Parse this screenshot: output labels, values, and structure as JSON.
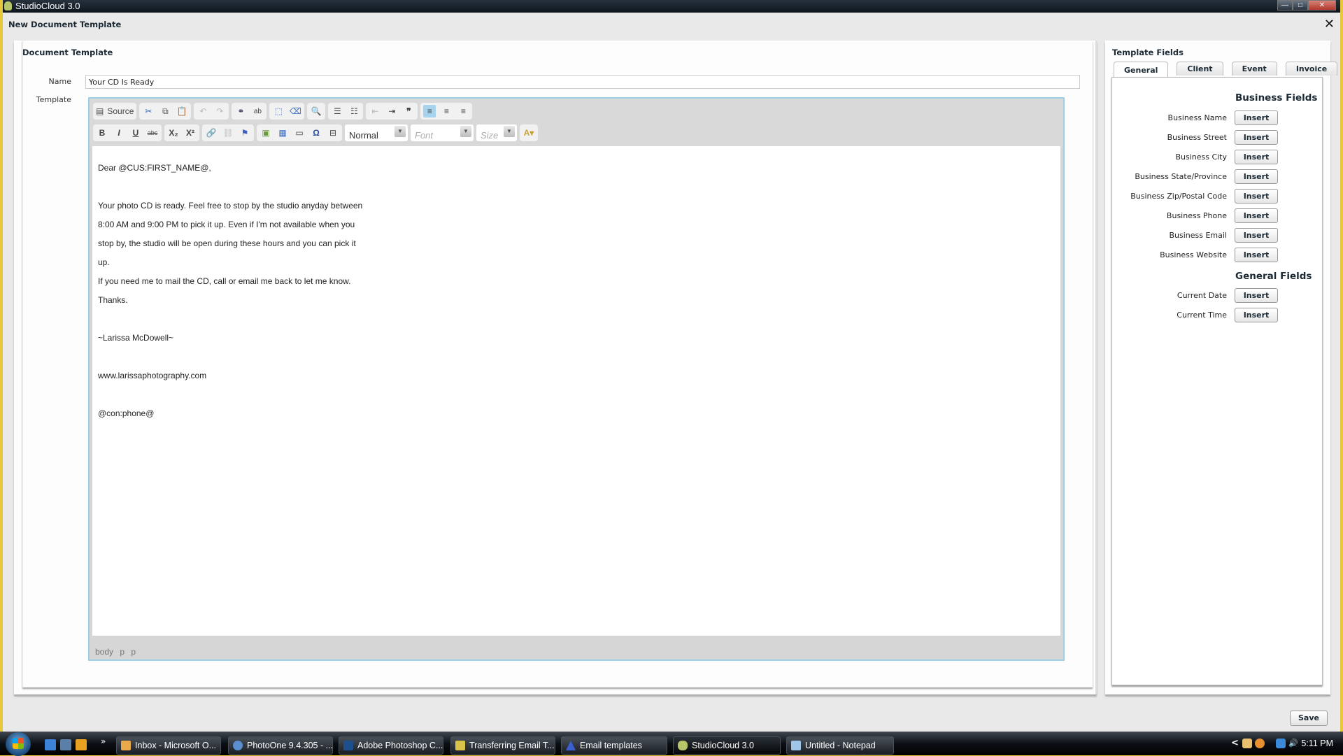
{
  "window": {
    "title": "StudioCloud 3.0",
    "controls": {
      "minimize": "—",
      "maximize": "□",
      "close": "✕"
    }
  },
  "dialog": {
    "title": "New Document Template",
    "close_icon": "✕"
  },
  "document_template": {
    "section_title": "Document Template",
    "name_label": "Name",
    "name_value": "Your CD Is Ready",
    "template_label": "Template",
    "toolbar": {
      "row1": [
        {
          "name": "source",
          "label": "Source",
          "icon": "source-icon"
        },
        {
          "name": "cut",
          "icon": "scissors-icon"
        },
        {
          "name": "copy",
          "icon": "copy-icon"
        },
        {
          "name": "paste",
          "icon": "paste-icon"
        },
        {
          "name": "undo",
          "icon": "undo-icon"
        },
        {
          "name": "redo",
          "icon": "redo-icon"
        },
        {
          "name": "find",
          "icon": "binoculars-icon"
        },
        {
          "name": "replace",
          "icon": "replace-icon"
        },
        {
          "name": "select-all",
          "icon": "select-all-icon"
        },
        {
          "name": "remove-format",
          "icon": "eraser-icon"
        },
        {
          "name": "preview",
          "icon": "preview-icon"
        },
        {
          "name": "numbered-list",
          "icon": "ordered-list-icon"
        },
        {
          "name": "bulleted-list",
          "icon": "bullet-list-icon"
        },
        {
          "name": "outdent",
          "icon": "outdent-icon"
        },
        {
          "name": "indent",
          "icon": "indent-icon"
        },
        {
          "name": "blockquote",
          "icon": "quote-icon"
        },
        {
          "name": "align-left",
          "icon": "align-left-icon",
          "active": true
        },
        {
          "name": "align-center",
          "icon": "align-center-icon"
        },
        {
          "name": "align-right",
          "icon": "align-right-icon"
        }
      ],
      "format_value": "Normal",
      "font_placeholder": "Font",
      "size_placeholder": "Size"
    },
    "content": {
      "lines": [
        " Dear @CUS:FIRST_NAME@,",
        "Your photo CD is ready. Feel free to stop by the studio anyday between",
        "8:00 AM and 9:00 PM to pick it up. Even if I'm not available when you",
        "stop by, the studio will be open during these hours and you can pick it",
        "up.",
        "If you need me to mail the CD, call or email me back to let me know.",
        "Thanks.",
        "~Larissa McDowell~",
        "www.larissaphotography.com",
        "@con:phone@"
      ]
    },
    "element_path": [
      "body",
      "p",
      "p"
    ]
  },
  "template_fields": {
    "title": "Template Fields",
    "tabs": [
      {
        "label": "General",
        "active": true
      },
      {
        "label": "Client",
        "active": false
      },
      {
        "label": "Event",
        "active": false
      },
      {
        "label": "Invoice",
        "active": false
      }
    ],
    "groups": [
      {
        "title": "Business Fields",
        "fields": [
          {
            "label": "Business Name",
            "button": "Insert"
          },
          {
            "label": "Business Street",
            "button": "Insert"
          },
          {
            "label": "Business City",
            "button": "Insert"
          },
          {
            "label": "Business State/Province",
            "button": "Insert"
          },
          {
            "label": "Business Zip/Postal Code",
            "button": "Insert"
          },
          {
            "label": "Business Phone",
            "button": "Insert"
          },
          {
            "label": "Business Email",
            "button": "Insert"
          },
          {
            "label": "Business Website",
            "button": "Insert"
          }
        ]
      },
      {
        "title": "General Fields",
        "fields": [
          {
            "label": "Current Date",
            "button": "Insert"
          },
          {
            "label": "Current Time",
            "button": "Insert"
          }
        ]
      }
    ]
  },
  "save_label": "Save",
  "taskbar": {
    "items": [
      {
        "label": "Inbox - Microsoft O...",
        "color": "#e8a94a"
      },
      {
        "label": "PhotoOne 9.4.305 - ...",
        "color": "#5a8fd0"
      },
      {
        "label": "Adobe Photoshop C...",
        "color": "#1d4f8c"
      },
      {
        "label": "Transferring Email T...",
        "color": "#d8c24a"
      },
      {
        "label": "Email templates",
        "color": "#3a5fd0"
      },
      {
        "label": "StudioCloud 3.0",
        "color": "#b6c46a",
        "active": true
      },
      {
        "label": "Untitled - Notepad",
        "color": "#9fc6e8"
      }
    ],
    "overflow": "»",
    "tray_expand": "<",
    "clock": "5:11 PM"
  }
}
